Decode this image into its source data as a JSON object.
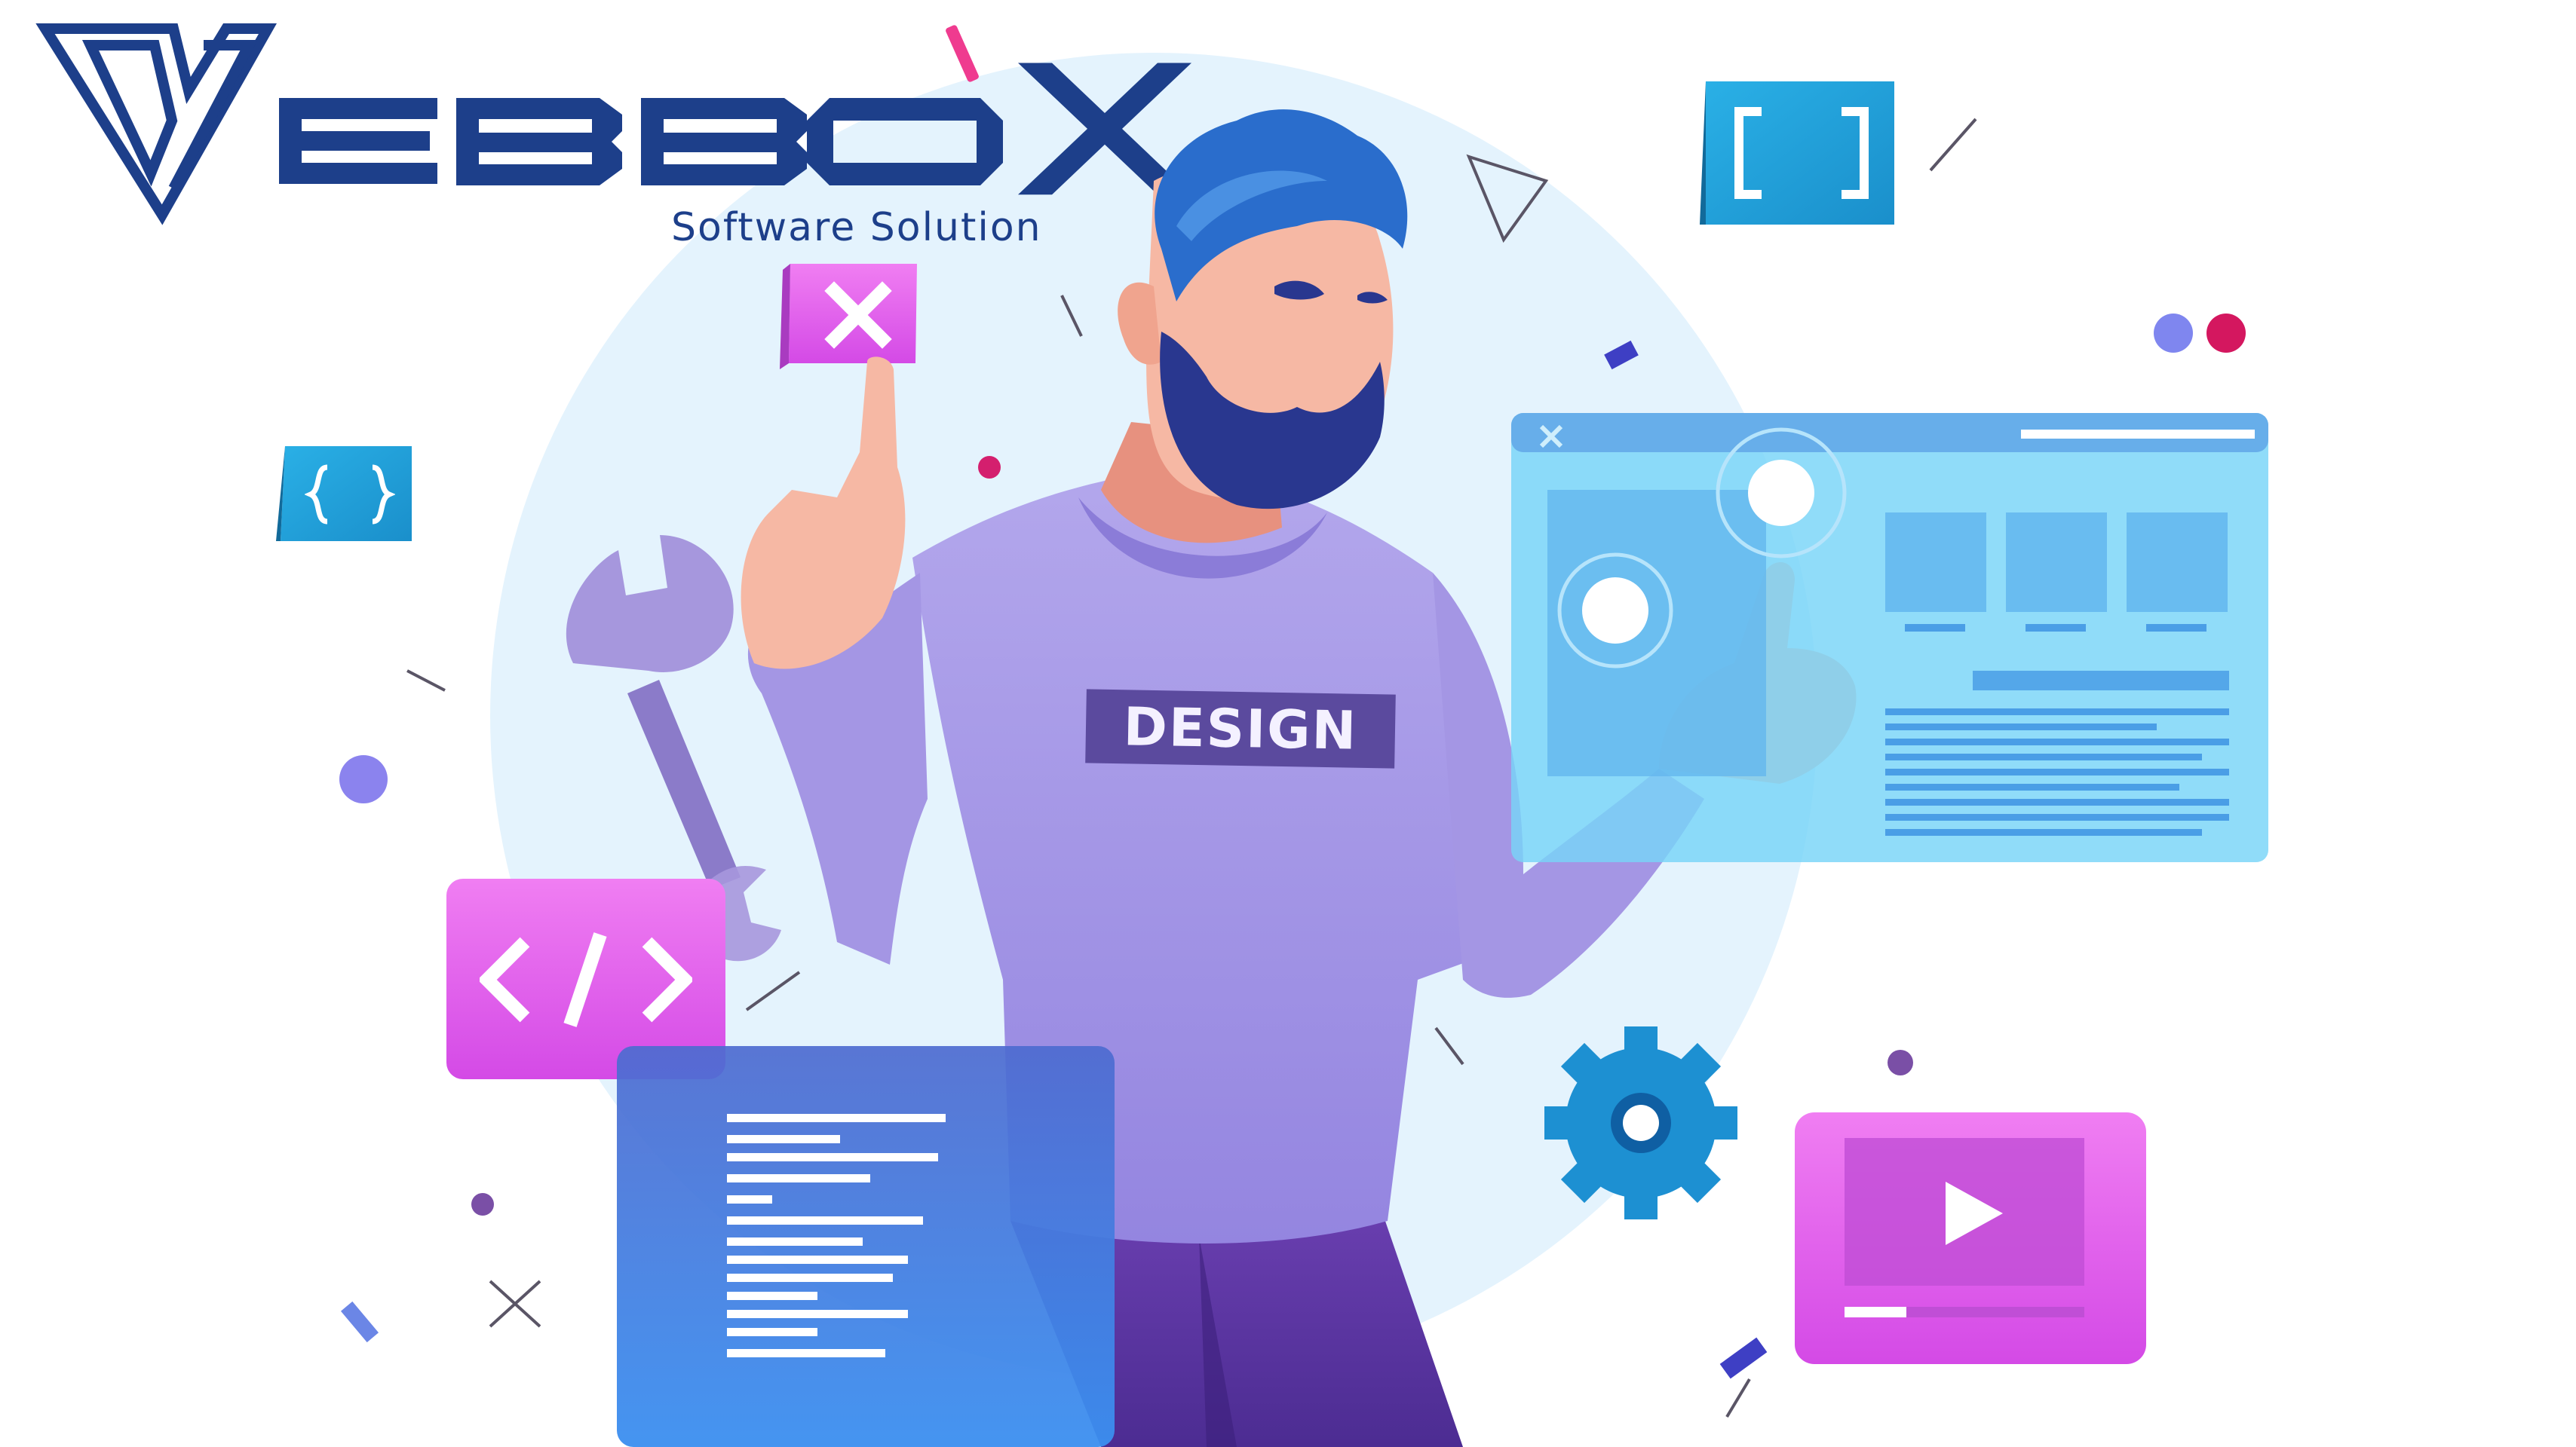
{
  "brand": {
    "logo_text": "EBBOX",
    "tagline": "Software Solution",
    "color": "#1d3f8a"
  },
  "shirt": {
    "label": "DESIGN",
    "color": "#a79be6",
    "label_bg": "#5b4a9e"
  },
  "icons": {
    "close_card": "close-icon",
    "code_card": "code-icon",
    "curly_braces": "curly-braces-icon",
    "square_brackets": "square-brackets-icon",
    "wrench": "wrench-icon",
    "gear": "gear-icon",
    "play": "play-icon",
    "window_close": "window-close-icon"
  },
  "colors": {
    "pink": "#e052e8",
    "blue": "#29a8de",
    "backdrop": "#e4f3fd",
    "panel": "#78d4f8",
    "code_panel": "#3f72db",
    "gear": "#1d90d2"
  }
}
